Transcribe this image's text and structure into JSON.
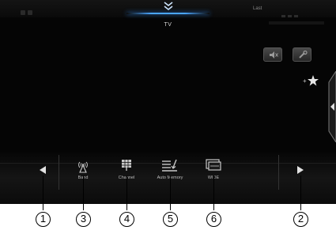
{
  "header": {
    "title": "TV",
    "status_right": "Last"
  },
  "top_buttons": [
    {
      "name": "mute-button",
      "icon": "speaker-mute-icon"
    },
    {
      "name": "settings-button",
      "icon": "wrench-icon"
    }
  ],
  "favorite": {
    "label": "+★",
    "icon": "add-favorite-star-icon"
  },
  "bottom_bar": {
    "prev_icon": "triangle-left-icon",
    "next_icon": "triangle-right-icon",
    "buttons": [
      {
        "label": "Band",
        "icon": "antenna-icon"
      },
      {
        "label": "Channel",
        "icon": "channel-grid-icon"
      },
      {
        "label": "Auto Memory",
        "icon": "auto-memory-icon"
      },
      {
        "label": "WIDE",
        "icon": "wide-screen-icon"
      }
    ]
  },
  "callouts": [
    "1",
    "2",
    "3",
    "4",
    "5",
    "6"
  ],
  "colors": {
    "accent": "#4aa6ff",
    "screen_bg": "#050505",
    "label": "#bdbdbd"
  }
}
